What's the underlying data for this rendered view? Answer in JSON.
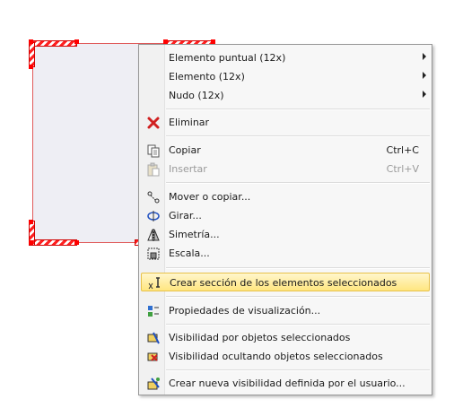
{
  "menu": {
    "items": [
      {
        "label": "Elemento puntual (12x)",
        "submenu": true
      },
      {
        "label": "Elemento (12x)",
        "submenu": true
      },
      {
        "label": "Nudo (12x)",
        "submenu": true
      },
      {
        "label": "Eliminar",
        "icon": "delete-x-icon"
      },
      {
        "label": "Copiar",
        "shortcut": "Ctrl+C",
        "icon": "copy-icon"
      },
      {
        "label": "Insertar",
        "shortcut": "Ctrl+V",
        "disabled": true,
        "icon": "paste-icon"
      },
      {
        "label": "Mover o copiar...",
        "icon": "move-copy-icon"
      },
      {
        "label": "Girar...",
        "icon": "rotate-icon"
      },
      {
        "label": "Simetría...",
        "icon": "mirror-icon"
      },
      {
        "label": "Escala...",
        "icon": "scale-icon"
      },
      {
        "label": "Crear sección de los elementos seleccionados",
        "highlighted": true,
        "icon": "section-icon"
      },
      {
        "label": "Propiedades de visualización...",
        "icon": "display-properties-icon"
      },
      {
        "label": "Visibilidad por objetos seleccionados",
        "icon": "visibility-selected-icon"
      },
      {
        "label": "Visibilidad ocultando objetos seleccionados",
        "icon": "visibility-hide-icon"
      },
      {
        "label": "Crear nueva visibilidad definida por el usuario...",
        "icon": "new-visibility-icon"
      }
    ]
  },
  "colors": {
    "selection_red": "#ff0000",
    "highlight": "#ffe680",
    "menu_bg": "#f7f7f7"
  }
}
